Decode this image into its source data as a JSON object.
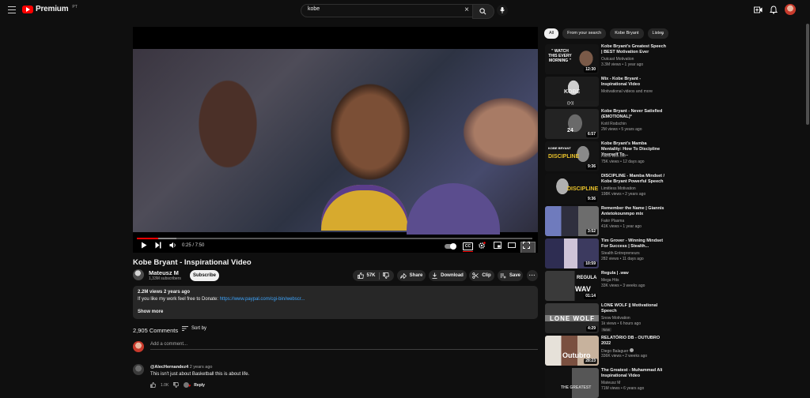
{
  "header": {
    "logo_text": "Premium",
    "logo_sup": "PT",
    "search_value": "kobe"
  },
  "player": {
    "time": "0:25 / 7:50",
    "progress_fraction": 0.053,
    "cc_label": "CC"
  },
  "video": {
    "title": "Kobe Bryant - Inspirational Video",
    "channel": "Mateusz M",
    "subscribers": "1,33M subscribers",
    "subscribe_label": "Subscribe",
    "likes": "57K",
    "share_label": "Share",
    "download_label": "Download",
    "clip_label": "Clip",
    "save_label": "Save"
  },
  "description": {
    "views": "2.2M views  2 years ago",
    "text": "If you like my work feel free to Donate: ",
    "link": "https://www.paypal.com/cgi-bin/webscr...",
    "show_more": "Show more"
  },
  "comments": {
    "count": "2,905 Comments",
    "sort_label": "Sort by",
    "add_placeholder": "Add a comment...",
    "items": [
      {
        "author": "@AlecHernandez4",
        "time": "2 years ago",
        "text": "This isn't just about Basketball this is about life.",
        "likes": "1.0K",
        "reply": "Reply"
      }
    ]
  },
  "chips": [
    "All",
    "From your search",
    "Kobe Bryant",
    "Listen"
  ],
  "recommendations": [
    {
      "title": "Kobe Bryant's Greatest Speech | BEST Motivation Ever",
      "channel": "Outcast Motivation",
      "meta": "3.3M views  •  1 year ago",
      "duration": "12:30",
      "thumb_text": "\" WATCH THIS EVERY MORNING \""
    },
    {
      "title": "Mix - Kobe Bryant - Inspirational Video",
      "channel": "Motivational videos and more",
      "meta": "",
      "duration": "",
      "thumb_text": "KOBE"
    },
    {
      "title": "Kobe Bryant - Never Satisfied (EMOTIONAL)*",
      "channel": "Kotil Rodschin",
      "meta": "2M views  •  5 years ago",
      "duration": "6:57",
      "thumb_text": "24"
    },
    {
      "title": "Kobe Bryant's Mamba Mentality: How To Discipline Yourself To...",
      "channel": "Facts with oni",
      "meta": "75K views  •  12 days ago",
      "duration": "9:36",
      "thumb_text": "DISCIPLINE"
    },
    {
      "title": "DISCIPLINE - Mamba Mindset / Kobe Bryant Powerful Speech",
      "channel": "Limitless Motivation",
      "meta": "198K views  •  2 years ago",
      "duration": "9:36",
      "thumb_text": "DISCIPLINE"
    },
    {
      "title": "Remember the Name | Giannis Antetokounmpo mix",
      "channel": "Fakir Plasma",
      "meta": "41K views  •  1 year ago",
      "duration": "3:52",
      "thumb_text": ""
    },
    {
      "title": "Tim Grover - Winning Mindset For Success | Stealth...",
      "channel": "Stealth Entrepreneurs",
      "meta": "282 views  •  11 days ago",
      "duration": "10:59",
      "thumb_text": ""
    },
    {
      "title": "Regula | .wav",
      "channel": "Mega Hits",
      "meta": "33K views  •  3 weeks ago",
      "duration": "01:14",
      "thumb_text": "REGULA"
    },
    {
      "title": "LONE WOLF || Motivational Speech",
      "channel": "Snow Motivation",
      "meta": "1k views  •  6 hours ago",
      "duration": "4:29",
      "thumb_text": "LONE WOLF",
      "badge": "New"
    },
    {
      "title": "RELATÓRIO DB - OUTUBRO 2022",
      "channel": "Diego Balaguer",
      "meta": "336K views  •  2 weeks ago",
      "duration": "28:23",
      "thumb_text": "Outubro"
    },
    {
      "title": "The Greatest - Muhammad Ali Inspirational Video",
      "channel": "Mateusz M",
      "meta": "71M views  •  6 years ago",
      "duration": "",
      "thumb_text": "THE GREATEST"
    }
  ]
}
